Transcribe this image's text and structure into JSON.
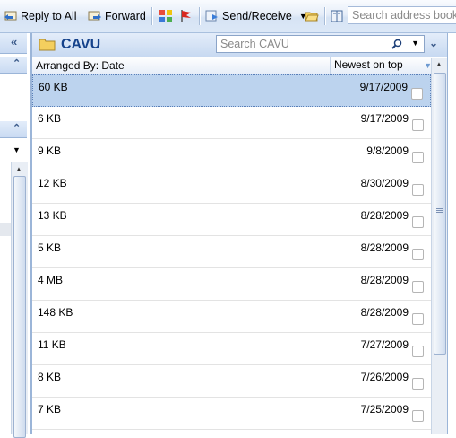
{
  "toolbar": {
    "reply_all": "Reply to All",
    "forward": "Forward",
    "send_receive": "Send/Receive",
    "address_search_placeholder": "Search address books"
  },
  "folder": {
    "name": "CAVU",
    "search_placeholder": "Search CAVU"
  },
  "arrange": {
    "label": "Arranged By: Date",
    "sort": "Newest on top"
  },
  "messages": [
    {
      "size": "60 KB",
      "date": "9/17/2009",
      "selected": true
    },
    {
      "size": "6 KB",
      "date": "9/17/2009"
    },
    {
      "size": "9 KB",
      "date": "9/8/2009"
    },
    {
      "size": "12 KB",
      "date": "8/30/2009"
    },
    {
      "size": "13 KB",
      "date": "8/28/2009"
    },
    {
      "size": "5 KB",
      "date": "8/28/2009"
    },
    {
      "size": "4 MB",
      "date": "8/28/2009"
    },
    {
      "size": "148 KB",
      "date": "8/28/2009"
    },
    {
      "size": "11 KB",
      "date": "7/27/2009"
    },
    {
      "size": "8 KB",
      "date": "7/26/2009"
    },
    {
      "size": "7 KB",
      "date": "7/25/2009"
    }
  ],
  "colors": {
    "accent": "#15428b",
    "selection": "#bcd3ee",
    "border": "#9bb5d8"
  },
  "icons": [
    "reply-all-icon",
    "forward-icon",
    "categorize-icon",
    "flag-icon",
    "send-receive-icon",
    "folder-open-icon",
    "address-book-icon",
    "folder-icon",
    "search-icon"
  ]
}
